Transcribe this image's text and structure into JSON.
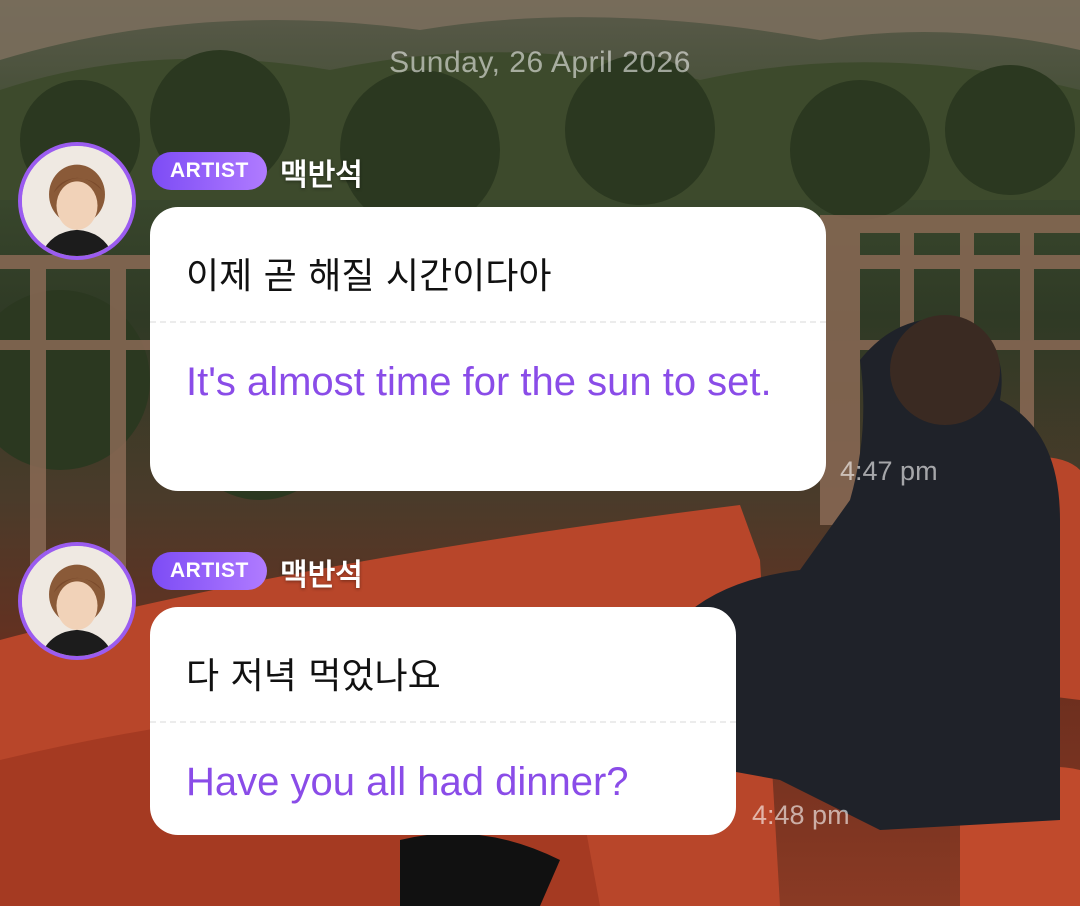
{
  "date_separator": "Sunday, 26 April 2026",
  "messages": [
    {
      "badge": "ARTIST",
      "sender": "맥반석",
      "korean": "이제 곧 해질 시간이다아",
      "translation": "It's almost time for the sun to set.",
      "time": "4:47 pm"
    },
    {
      "badge": "ARTIST",
      "sender": "맥반석",
      "korean": "다 저녁 먹었나요",
      "translation": "Have you all had dinner?",
      "time": "4:48 pm"
    }
  ],
  "colors": {
    "accent": "#8a4ce8",
    "badge_start": "#7d4cf5",
    "badge_end": "#b07bff",
    "avatar_ring": "#9b5cf0"
  }
}
